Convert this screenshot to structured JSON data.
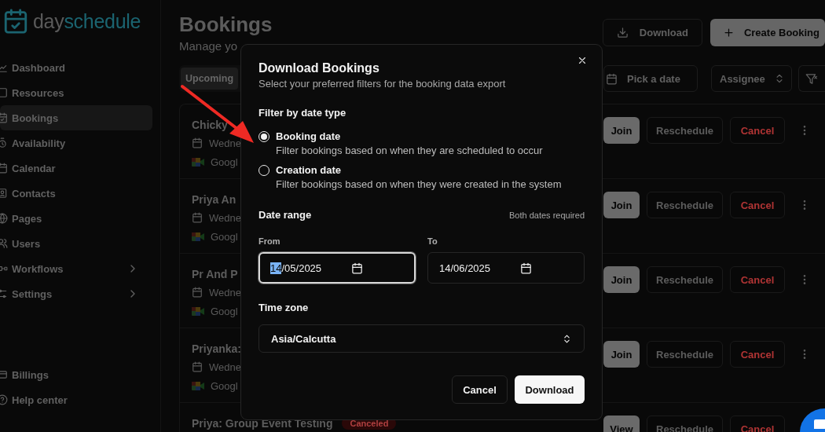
{
  "sidebar": {
    "logo": {
      "first": "day",
      "second": "schedule"
    },
    "items": [
      {
        "label": "Dashboard",
        "selected": false,
        "expandable": false
      },
      {
        "label": "Resources",
        "selected": false,
        "expandable": false
      },
      {
        "label": "Bookings",
        "selected": true,
        "expandable": false
      },
      {
        "label": "Availability",
        "selected": false,
        "expandable": false
      },
      {
        "label": "Calendar",
        "selected": false,
        "expandable": false
      },
      {
        "label": "Contacts",
        "selected": false,
        "expandable": false
      },
      {
        "label": "Pages",
        "selected": false,
        "expandable": false
      },
      {
        "label": "Users",
        "selected": false,
        "expandable": false
      },
      {
        "label": "Workflows",
        "selected": false,
        "expandable": true
      },
      {
        "label": "Settings",
        "selected": false,
        "expandable": true
      }
    ],
    "footer_items": [
      {
        "label": "Billings"
      },
      {
        "label": "Help center"
      }
    ]
  },
  "header": {
    "title": "Bookings",
    "subtitle": "Manage yo",
    "actions": [
      {
        "label": "Download",
        "kind": "outline"
      },
      {
        "label": "Create Booking",
        "kind": "filled"
      }
    ]
  },
  "toolbar": {
    "tabs": [
      {
        "label": "Upcoming",
        "selected": true
      }
    ],
    "date_picker": "Pick a date",
    "assignee_select": "Assignee"
  },
  "bookings": [
    {
      "title": "Chicky",
      "date": "Wedne",
      "location": "Googl",
      "has_menu": true,
      "actions": [
        {
          "label": "Join",
          "kind": "primary"
        },
        {
          "label": "Reschedule",
          "kind": "outline"
        },
        {
          "label": "Cancel",
          "kind": "danger"
        }
      ]
    },
    {
      "title": "Priya An",
      "date": "Wedne",
      "location": "Googl",
      "has_menu": true,
      "actions": [
        {
          "label": "Join",
          "kind": "primary"
        },
        {
          "label": "Reschedule",
          "kind": "outline"
        },
        {
          "label": "Cancel",
          "kind": "danger"
        }
      ]
    },
    {
      "title": "Pr And P",
      "date": "Wedne",
      "location": "Googl",
      "has_menu": true,
      "actions": [
        {
          "label": "Join",
          "kind": "primary"
        },
        {
          "label": "Reschedule",
          "kind": "outline"
        },
        {
          "label": "Cancel",
          "kind": "danger"
        }
      ]
    },
    {
      "title": "Priyanka:",
      "date": "Wedne",
      "location": "Googl",
      "has_menu": true,
      "actions": [
        {
          "label": "Join",
          "kind": "primary"
        },
        {
          "label": "Reschedule",
          "kind": "outline"
        },
        {
          "label": "Cancel",
          "kind": "danger"
        }
      ]
    },
    {
      "title": "Priya: Group Event Testing",
      "status": "Canceled",
      "has_menu": false,
      "actions": [
        {
          "label": "View",
          "kind": "primary"
        },
        {
          "label": "Reschedule",
          "kind": "outline"
        },
        {
          "label": "Cancel",
          "kind": "danger"
        }
      ]
    }
  ],
  "dialog": {
    "title": "Download Bookings",
    "subtitle": "Select your preferred filters for the booking data export",
    "filter_label": "Filter by date type",
    "options": [
      {
        "label": "Booking date",
        "description": "Filter bookings based on when they are scheduled to occur",
        "selected": true
      },
      {
        "label": "Creation date",
        "description": "Filter bookings based on when they were created in the system",
        "selected": false
      }
    ],
    "date_range_label": "Date range",
    "date_hint": "Both dates required",
    "date_from": {
      "label": "From",
      "value": "14/05/2025",
      "focused": true
    },
    "date_to": {
      "label": "To",
      "value": "14/06/2025",
      "focused": false
    },
    "timezone": {
      "label": "Time zone",
      "value": "Asia/Calcutta"
    },
    "buttons": [
      {
        "label": "Cancel",
        "kind": "outline"
      },
      {
        "label": "Download",
        "kind": "primary"
      }
    ]
  }
}
